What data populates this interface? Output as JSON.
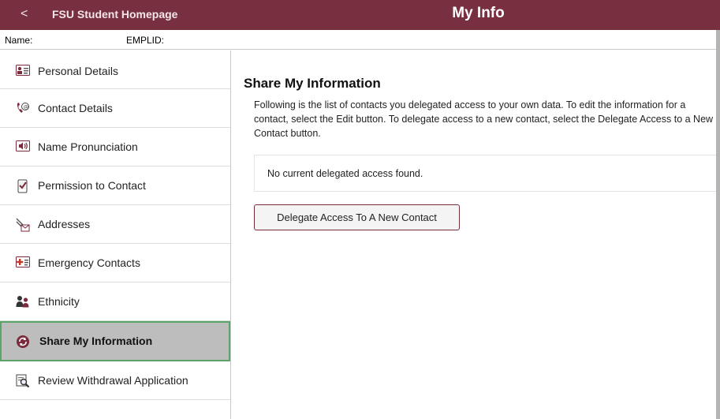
{
  "banner": {
    "back_glyph": "<",
    "home_link": "FSU Student Homepage",
    "title": "My Info",
    "color": "#782f40"
  },
  "namebar": {
    "name_label": "Name:",
    "emplid_label": "EMPLID:"
  },
  "sidebar": {
    "items": [
      {
        "label": "Personal Details",
        "icon": "id-card-icon"
      },
      {
        "label": "Contact Details",
        "icon": "phone-email-icon"
      },
      {
        "label": "Name Pronunciation",
        "icon": "speaker-icon"
      },
      {
        "label": "Permission to Contact",
        "icon": "phone-check-icon"
      },
      {
        "label": "Addresses",
        "icon": "address-envelope-icon"
      },
      {
        "label": "Emergency Contacts",
        "icon": "medical-cross-icon"
      },
      {
        "label": "Ethnicity",
        "icon": "people-icon"
      },
      {
        "label": "Share My Information",
        "icon": "share-arrows-icon",
        "active": true
      },
      {
        "label": "Review Withdrawal Application",
        "icon": "magnifier-document-icon"
      }
    ],
    "active_border_color": "#5aa469"
  },
  "main": {
    "section_title": "Share My Information",
    "instructions": "Following is the list of contacts you delegated access to your own data. To edit the information for a contact, select the Edit button. To delegate access to a new contact, select the Delegate Access to a New Contact button.",
    "empty_message": "No current delegated access found.",
    "delegate_button": "Delegate Access To A New Contact"
  }
}
